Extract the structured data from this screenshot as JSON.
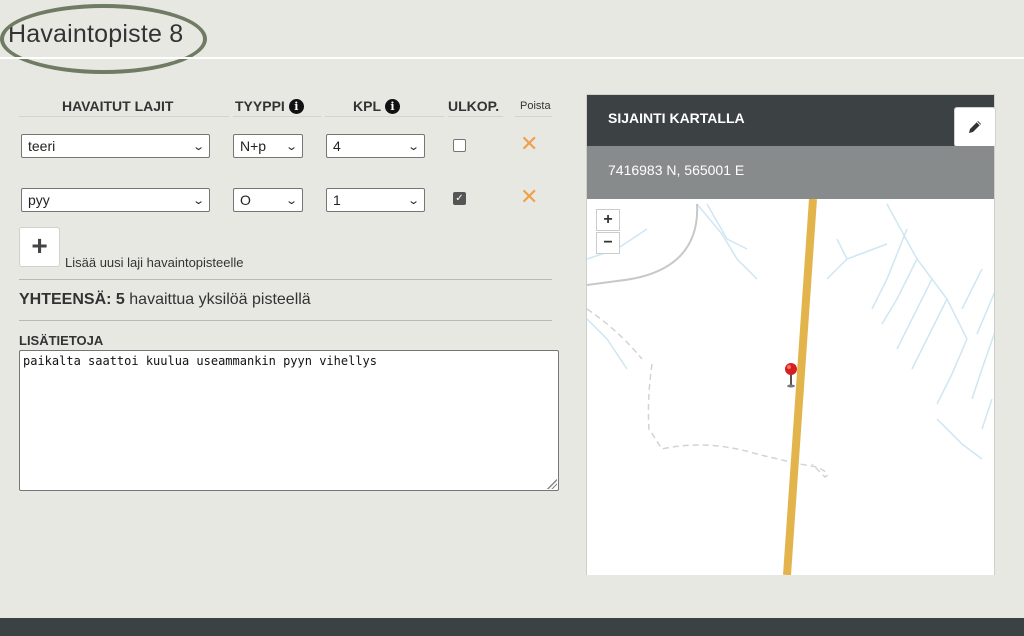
{
  "page": {
    "title": "Havaintopiste 8"
  },
  "table": {
    "headers": {
      "species": "HAVAITUT LAJIT",
      "type": "TYYPPI",
      "count": "KPL",
      "outside": "ULKOP.",
      "remove": "Poista"
    },
    "rows": [
      {
        "species": "teeri",
        "type": "N+p",
        "count": "4",
        "outside": false
      },
      {
        "species": "pyy",
        "type": "O",
        "count": "1",
        "outside": true
      }
    ],
    "info_icon_glyph": "i",
    "remove_icon": "close-icon",
    "dropdown_icon": "chevron-down-icon"
  },
  "add_species": {
    "icon": "+",
    "label": "Lisää uusi laji havaintopisteelle"
  },
  "total": {
    "label": "YHTEENSÄ:",
    "count": "5",
    "suffix": "havaittua yksilöä pisteellä"
  },
  "notes": {
    "label": "LISÄTIETOJA",
    "value": "paikalta saattoi kuulua useammankin pyyn vihellys"
  },
  "map": {
    "title": "SIJAINTI KARTALLA",
    "coordinates": "7416983 N, 565001 E",
    "zoom_in": "+",
    "zoom_out": "−",
    "edit_icon": "pencil-icon",
    "marker_icon": "map-pin-icon"
  },
  "colors": {
    "accent_remove": "#f0a04b",
    "map_header": "#3c4143",
    "coord_bar": "#878b8c",
    "title_oval": "#6f7b62",
    "road": "#e3b44c"
  }
}
